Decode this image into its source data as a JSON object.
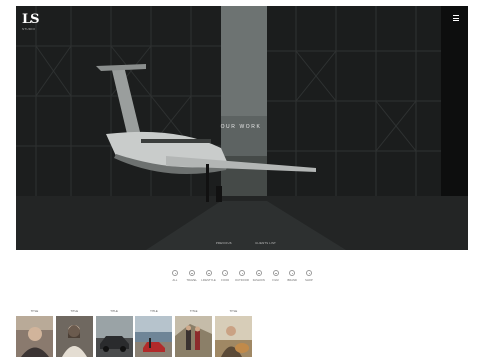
{
  "header": {
    "logo_text": "LS",
    "logo_sub": "STUDIO",
    "menu_icon": "hamburger-icon"
  },
  "hero": {
    "title": "OUR WORK",
    "links": [
      "PREVIOUS",
      "CLIENTS LIST"
    ]
  },
  "categories": [
    {
      "label": "ALL",
      "icon": "circle-icon"
    },
    {
      "label": "TRAVEL",
      "icon": "circle-icon"
    },
    {
      "label": "LIFESTYLE",
      "icon": "circle-icon"
    },
    {
      "label": "FOOD",
      "icon": "circle-icon"
    },
    {
      "label": "OUTDOOR",
      "icon": "circle-icon"
    },
    {
      "label": "FASHION",
      "icon": "circle-icon"
    },
    {
      "label": "FILM",
      "icon": "circle-icon"
    },
    {
      "label": "BRAND",
      "icon": "circle-icon"
    },
    {
      "label": "SHOP",
      "icon": "circle-icon"
    }
  ],
  "thumbnails": [
    {
      "label": "TITLE",
      "image": "portrait-man-dark-coat",
      "color": "#8a7a6e"
    },
    {
      "label": "TITLE",
      "image": "portrait-woman-knit",
      "color": "#b7ada1"
    },
    {
      "label": "TITLE",
      "image": "car-on-road",
      "color": "#5a5b5c"
    },
    {
      "label": "TITLE",
      "image": "red-car-lake",
      "color": "#7e92a4"
    },
    {
      "label": "TITLE",
      "image": "couple-mountain-path",
      "color": "#9d8f78"
    },
    {
      "label": "TITLE",
      "image": "man-with-dog",
      "color": "#a8906c"
    }
  ]
}
